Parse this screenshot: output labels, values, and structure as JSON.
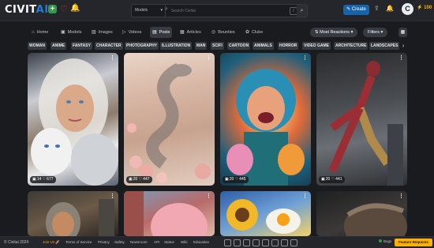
{
  "brand": {
    "logo_main": "CIVIT",
    "logo_accent": "AI"
  },
  "search": {
    "type_selected": "Models",
    "placeholder": "Search Civitai",
    "shortcut_key": "/"
  },
  "header": {
    "create_label": "Create",
    "buzz_count": "100",
    "avatar_letter": "C",
    "notification_badge": "1"
  },
  "nav": {
    "items": [
      {
        "label": "Home",
        "icon": "home-icon"
      },
      {
        "label": "Models",
        "icon": "models-icon"
      },
      {
        "label": "Images",
        "icon": "images-icon"
      },
      {
        "label": "Videos",
        "icon": "videos-icon"
      },
      {
        "label": "Posts",
        "icon": "posts-icon"
      },
      {
        "label": "Articles",
        "icon": "articles-icon"
      },
      {
        "label": "Bounties",
        "icon": "bounties-icon"
      },
      {
        "label": "Clubs",
        "icon": "clubs-icon"
      }
    ],
    "active_index": 4
  },
  "controls": {
    "sort_label": "Most Reactions",
    "filter_label": "Filters"
  },
  "tags": [
    "WOMAN",
    "ANIME",
    "FANTASY",
    "CHARACTER",
    "PHOTOGRAPHY",
    "ILLUSTRATION",
    "MAN",
    "SCIFI",
    "CARTOON",
    "ANIMALS",
    "HORROR",
    "VIDEO GAME",
    "ARCHITECTURE",
    "LANDSCAPES"
  ],
  "posts": [
    {
      "images": "14",
      "likes": "677"
    },
    {
      "images": "20",
      "likes": "447"
    },
    {
      "images": "20",
      "likes": "445"
    },
    {
      "images": "20",
      "likes": "441"
    }
  ],
  "footer": {
    "copyright": "© Civitai 2024",
    "links": [
      "Join Us 🚀",
      "Terms of Service",
      "Privacy",
      "Safety",
      "Newsroom",
      "API",
      "Status",
      "Wiki",
      "Education"
    ],
    "bugs_label": "Bugs",
    "feature_label": "Feature Requests"
  },
  "colors": {
    "accent": "#1864ab",
    "brand_blue": "#1c7ed6",
    "warning": "#fab005",
    "success": "#2f9e44",
    "danger": "#e03131"
  }
}
